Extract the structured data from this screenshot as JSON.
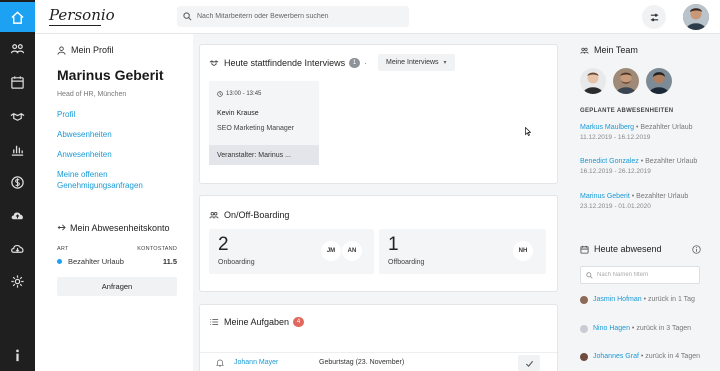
{
  "brand": {
    "logo_text": "Personio",
    "accent": "#1da1f2",
    "link_color": "#1a9ad6",
    "rail_bg": "#1f1f1f"
  },
  "rail": {
    "items": [
      {
        "icon": "home-icon",
        "active": true
      },
      {
        "icon": "people-icon",
        "active": false
      },
      {
        "icon": "calendar-icon",
        "active": false
      },
      {
        "icon": "handshake-icon",
        "active": false
      },
      {
        "icon": "bar-chart-icon",
        "active": false
      },
      {
        "icon": "dollar-icon",
        "active": false
      },
      {
        "icon": "cloud-upload-icon",
        "active": false
      },
      {
        "icon": "cloud-download-icon",
        "active": false
      },
      {
        "icon": "gear-icon",
        "active": false
      },
      {
        "icon": "info-icon",
        "active": false
      }
    ]
  },
  "topbar": {
    "search_placeholder": "Nach Mitarbeitern oder Bewerbern suchen"
  },
  "profile": {
    "section_title": "Mein Profil",
    "name": "Marinus Geberit",
    "role": "Head of HR, München",
    "links": [
      "Profil",
      "Abwesenheiten",
      "Anwesenheiten",
      "Meine offenen Genehmigungsanfragen"
    ]
  },
  "balance": {
    "title": "Mein Abwesenheitskonto",
    "col_type": "ART",
    "col_balance": "KONTOSTAND",
    "row_label": "Bezahlter Urlaub",
    "row_value": "11.5",
    "request_button": "Anfragen"
  },
  "interviews": {
    "title": "Heute stattfindende Interviews",
    "count": "1",
    "separator": "·",
    "filter_label": "Meine Interviews",
    "item": {
      "time": "13:00 - 13:45",
      "name": "Kevin Krause",
      "position": "SEO Marketing Manager",
      "organizer": "Veranstalter: Marinus ..."
    }
  },
  "onboarding": {
    "title": "On/Off-Boarding",
    "on_count": "2",
    "on_label": "Onboarding",
    "on_initials": [
      "JM",
      "AN"
    ],
    "off_count": "1",
    "off_label": "Offboarding",
    "off_initials": [
      "NH"
    ]
  },
  "tasks": {
    "title": "Meine Aufgaben",
    "count": "4",
    "count_color": "#e0685c",
    "rows": [
      {
        "person": "Johann Mayer",
        "description": "Geburtstag (23. November)"
      }
    ]
  },
  "team": {
    "title": "Mein Team",
    "planned_heading": "GEPLANTE ABWESENHEITEN",
    "planned": [
      {
        "name": "Markus Maulberg",
        "type": "• Bezahlter Urlaub",
        "dates": "11.12.2019 - 16.12.2019"
      },
      {
        "name": "Benedict Gonzalez",
        "type": "• Bezahlter Urlaub",
        "dates": "16.12.2019 - 26.12.2019"
      },
      {
        "name": "Marinus Geberit",
        "type": "• Bezahlter Urlaub",
        "dates": "23.12.2019 - 01.01.2020"
      }
    ],
    "today_title": "Heute abwesend",
    "today_search_placeholder": "Nach Namen filtern",
    "today": [
      {
        "name": "Jasmin Hofman",
        "note": "• zurück in 1 Tag",
        "avatar_color": "#8c6a58"
      },
      {
        "name": "Nino Hagen",
        "note": "• zurück in 3 Tagen",
        "avatar_color": "#c9ccd2"
      },
      {
        "name": "Johannes Graf",
        "note": "• zurück in 4 Tagen",
        "avatar_color": "#6e4d3f"
      }
    ]
  }
}
